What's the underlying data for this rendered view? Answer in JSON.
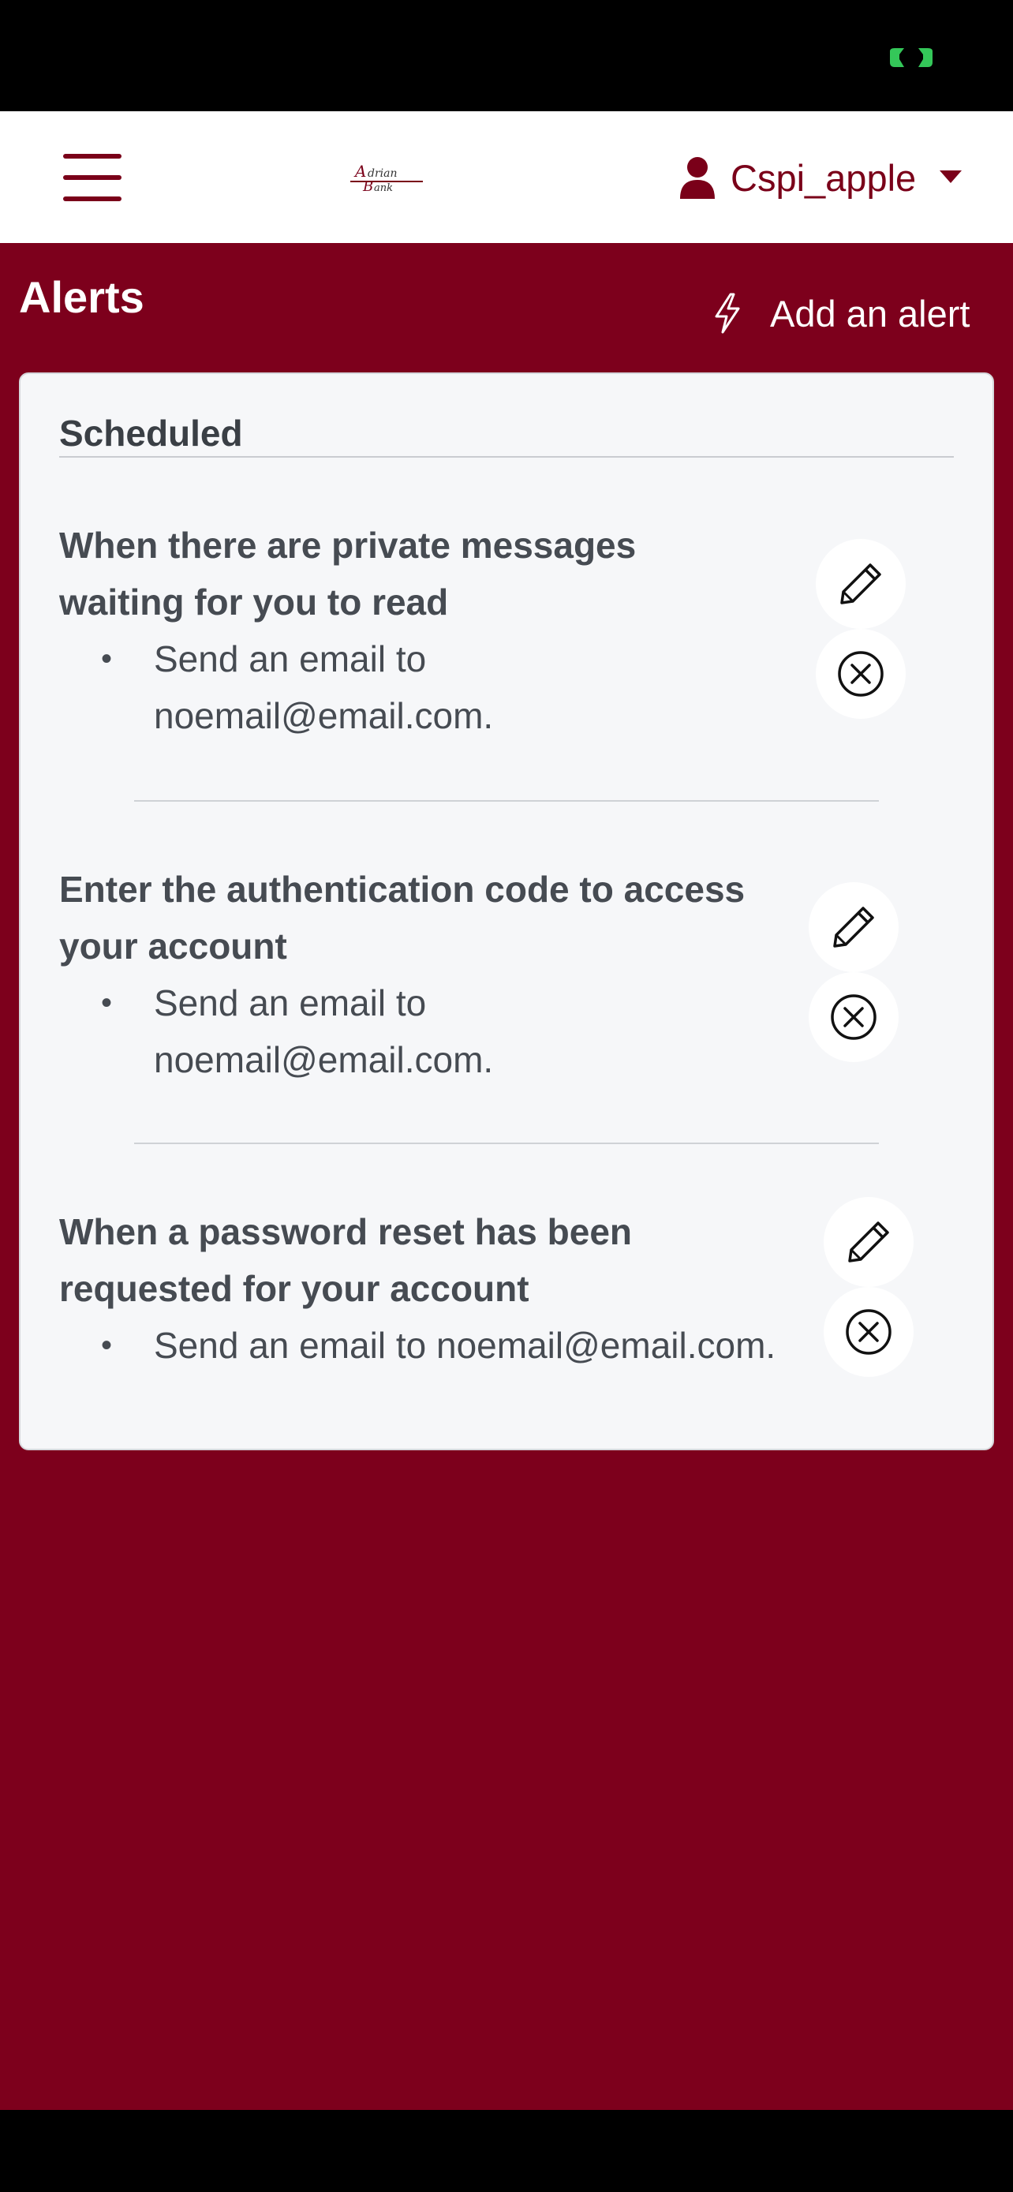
{
  "colors": {
    "brand": "#7d001c",
    "text": "#464b52",
    "card": "#f6f7f9",
    "status_indicator": "#34c759"
  },
  "header": {
    "menu_icon": "hamburger-icon",
    "logo_icon": "bank-logo",
    "logo_text": "Adrian Bank",
    "user_icon": "user-icon",
    "username": "Cspi_apple",
    "caret_icon": "caret-down-icon"
  },
  "page": {
    "title": "Alerts",
    "add_icon": "lightning-bolt-icon",
    "add_label": "Add an alert"
  },
  "scheduled": {
    "title": "Scheduled",
    "alerts": [
      {
        "title_line1": "When there are private messages",
        "title_line2": "waiting for you to read",
        "action_line1": "Send an email to",
        "action_line2": "noemail@email.com.",
        "edit_icon": "pencil-icon",
        "delete_icon": "circle-x-icon"
      },
      {
        "title_line1": "Enter the authentication code to access",
        "title_line2": "your account",
        "action_line1": "Send an email to",
        "action_line2": "noemail@email.com.",
        "edit_icon": "pencil-icon",
        "delete_icon": "circle-x-icon"
      },
      {
        "title_line1": "When a password reset has been",
        "title_line2": "requested for your account",
        "action_line1": "Send an email to noemail@email.com.",
        "edit_icon": "pencil-icon",
        "delete_icon": "circle-x-icon"
      }
    ]
  }
}
